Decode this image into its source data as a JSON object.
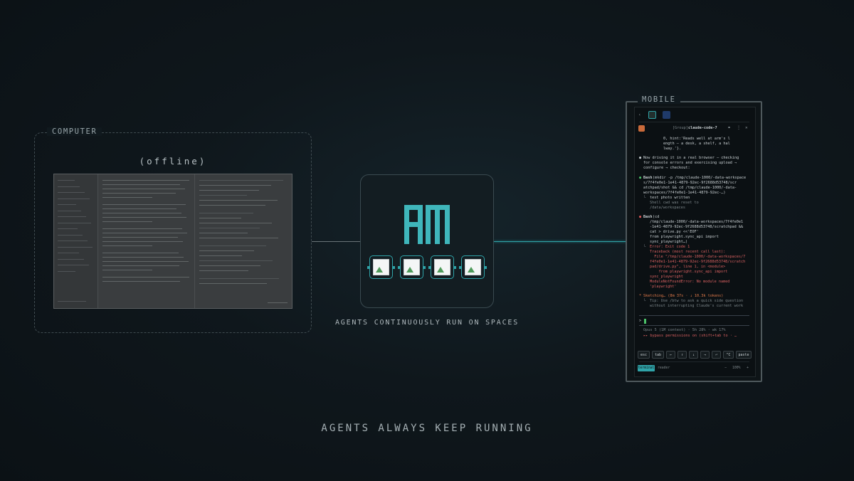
{
  "computer": {
    "label": "COMPUTER",
    "status": "(offline)"
  },
  "hub": {
    "caption": "AGENTS CONTINUOUSLY RUN ON SPACES",
    "agent_count": 4
  },
  "mobile": {
    "label": "MOBILE",
    "header": {
      "group_tag": "[Group]",
      "session_name": "claude-code-7"
    },
    "terminal_lines": [
      "0, hint:'Reads well at arm's l",
      "ength — a desk, a shelf, a hal",
      "lway.'}."
    ],
    "message": [
      "Now driving it in a real browser — checking",
      "for console errors and exercising upload →",
      "configure → checkout:"
    ],
    "bash1": {
      "label": "Bash",
      "cmd": [
        "(mkdir -p /tmp/claude-1000/-data-workspace",
        "s/7f4fe0e1-1e41-4879-92ec-9f2688d53748/scr",
        "atchpad/shot && cd /tmp/claude-1000/-data-",
        "workspaces/7f4fe0e1-1e41-4879-92ec-…)"
      ],
      "output": [
        "test photo written",
        "Shell cwd was reset to",
        "/data/workspaces"
      ]
    },
    "bash2": {
      "label": "Bash",
      "cmd": [
        "(cd",
        "/tmp/claude-1000/-data-workspaces/7f4fe0e1",
        "-1e41-4879-92ec-9f2688d53748/scratchpad &&",
        "cat > drive.py <<'EOF'",
        "from playwright.sync_api import",
        "sync_playwright…)"
      ],
      "error_lines": [
        "Error: Exit code 1",
        "Traceback (most recent call last):",
        "  File \"/tmp/claude-1000/-data-workspaces/7",
        "f4fe0e1-1e41-4879-92ec-9f2688d53748/scratch",
        "pad/drive.py\", line 1, in <module>",
        "    from playwright.sync_api import",
        "sync_playwright",
        "ModuleNotFoundError: No module named",
        "'playwright'"
      ]
    },
    "status_line": "Sketching… (8m 37s · ↓ 10.3k tokens)",
    "tip_lines": [
      "Tip: Use /btw to ask a quick side question",
      "without interrupting Claude's current work"
    ],
    "prompt": ">",
    "model_line": "Opus 5 (1M context) · 5h 28% · wk 17%",
    "permissions_line": "▸▸ bypass permissions on (shift+tab to · …",
    "keys": [
      "esc",
      "tab",
      "←",
      "↑",
      "↓",
      "→",
      "⏎",
      "^C",
      "paste"
    ],
    "bottom_tabs": [
      "terminal",
      "reader"
    ],
    "zoom": "100%",
    "zoom_minus": "−",
    "zoom_plus": "+"
  },
  "footer": {
    "title": "AGENTS ALWAYS KEEP RUNNING"
  },
  "colors": {
    "accent": "#2fa3a8",
    "background": "#10191e",
    "error": "#d86060",
    "success": "#4cc26a"
  }
}
